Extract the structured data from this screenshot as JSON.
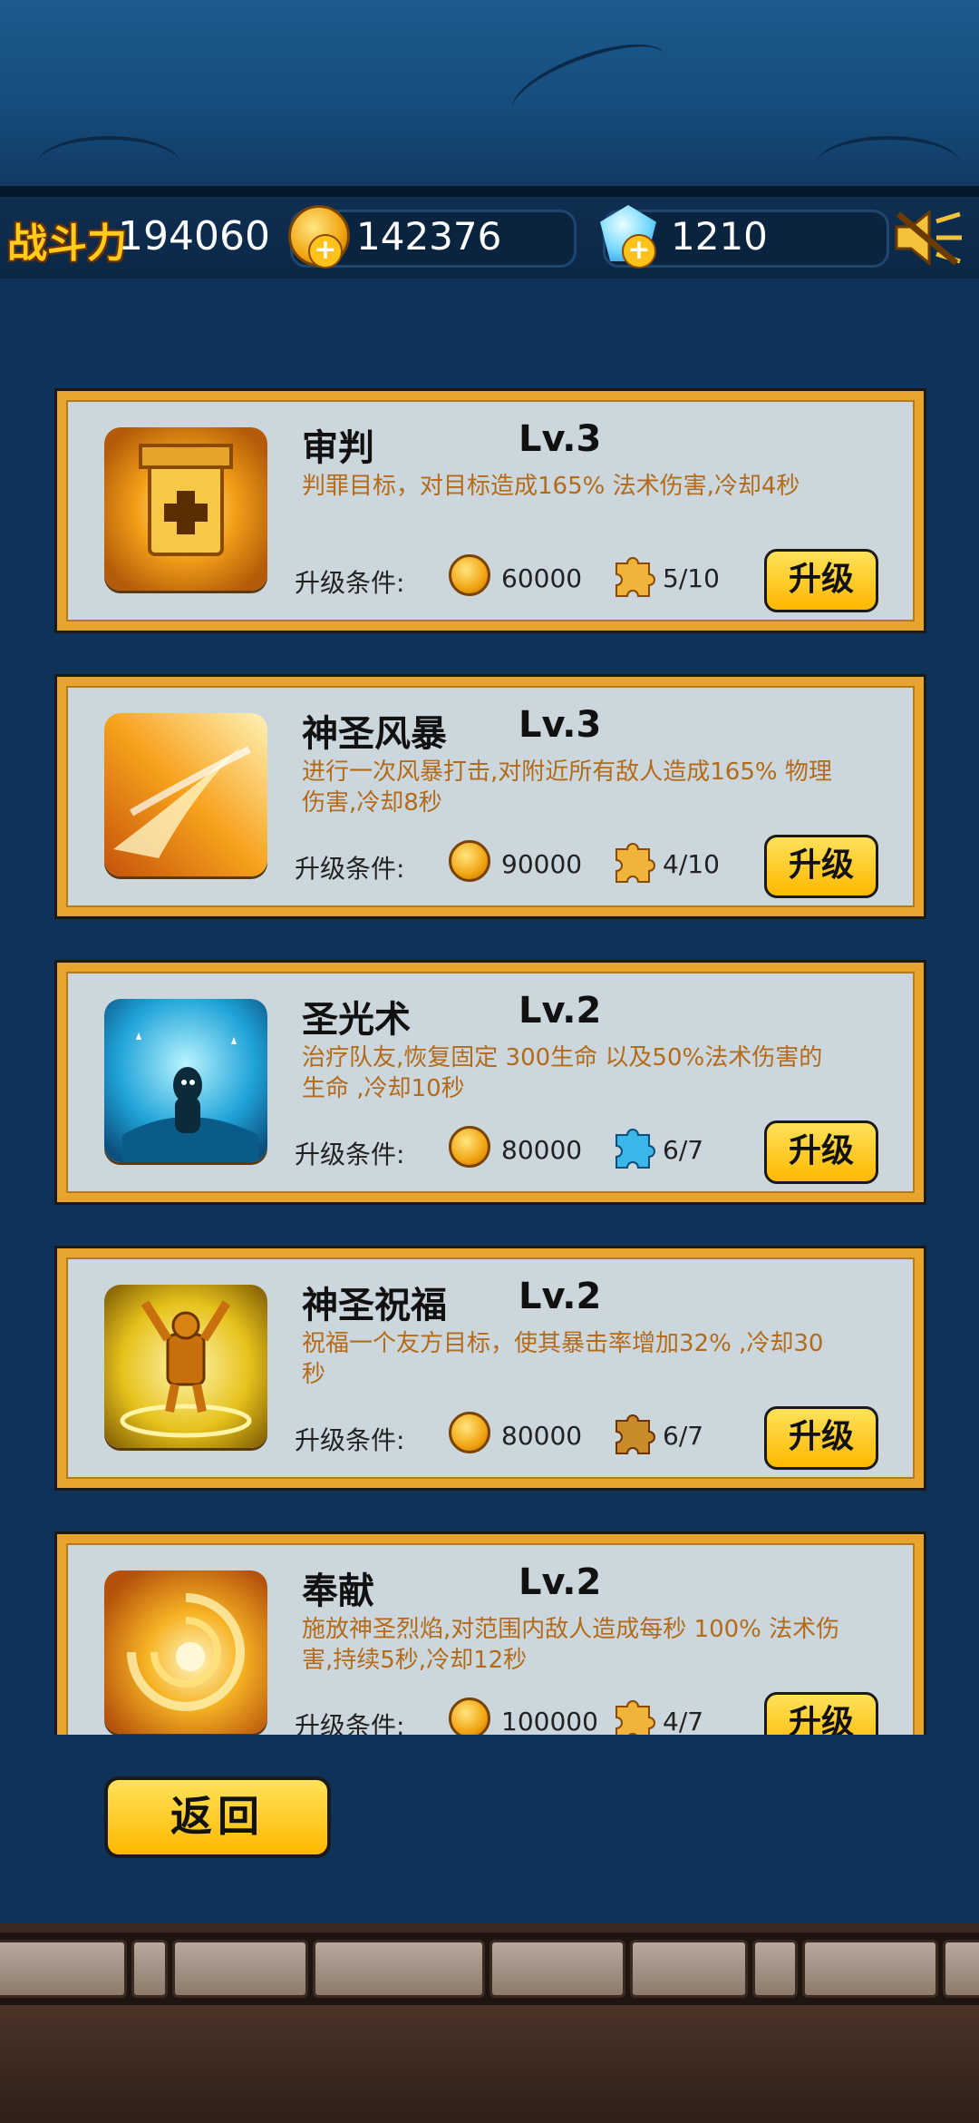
{
  "header": {
    "power_label": "战斗力",
    "power_value": "194060",
    "gold": "142376",
    "gems": "1210",
    "gold_icon": "coin-plus-icon",
    "gem_icon": "gem-plus-icon",
    "sound_icon": "speaker-muted-icon"
  },
  "skills": [
    {
      "name": "审判",
      "level": "Lv.3",
      "desc": "判罪目标，对目标造成165% 法术伤害,冷却4秒",
      "cond_label": "升级条件:",
      "cost": "60000",
      "fragments": "5/10",
      "button": "升级",
      "icon": "judgment-icon",
      "piece_color": "#f0b43a"
    },
    {
      "name": "神圣风暴",
      "level": "Lv.3",
      "desc": "进行一次风暴打击,对附近所有敌人造成165% 物理伤害,冷却8秒",
      "cond_label": "升级条件:",
      "cost": "90000",
      "fragments": "4/10",
      "button": "升级",
      "icon": "holy-storm-icon",
      "piece_color": "#f0b43a"
    },
    {
      "name": "圣光术",
      "level": "Lv.2",
      "desc": "治疗队友,恢复固定 300生命 以及50%法术伤害的生命 ,冷却10秒",
      "cond_label": "升级条件:",
      "cost": "80000",
      "fragments": "6/7",
      "button": "升级",
      "icon": "holy-light-icon",
      "piece_color": "#3bb6e8"
    },
    {
      "name": "神圣祝福",
      "level": "Lv.2",
      "desc": "祝福一个友方目标，使其暴击率增加32% ,冷却30秒",
      "cond_label": "升级条件:",
      "cost": "80000",
      "fragments": "6/7",
      "button": "升级",
      "icon": "holy-blessing-icon",
      "piece_color": "#c98a2a"
    },
    {
      "name": "奉献",
      "level": "Lv.2",
      "desc": "施放神圣烈焰,对范围内敌人造成每秒 100% 法术伤害,持续5秒,冷却12秒",
      "cond_label": "升级条件:",
      "cost": "100000",
      "fragments": "4/7",
      "button": "升级",
      "icon": "consecration-icon",
      "piece_color": "#f0b43a"
    }
  ],
  "back_button": "返回"
}
